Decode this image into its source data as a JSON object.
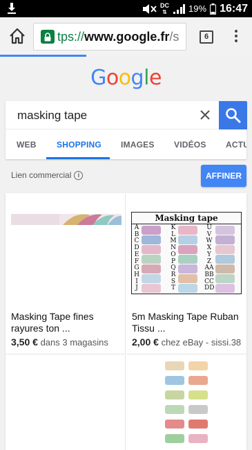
{
  "status_bar": {
    "network": "DC",
    "network_sub": "DC",
    "battery": "19%",
    "time": "16:47",
    "icons": [
      "download-icon",
      "mute-icon",
      "signal-icon",
      "battery-icon"
    ]
  },
  "browser": {
    "url_scheme": "tps://",
    "url_host": "www.google.fr",
    "url_rest": "/s",
    "tab_count": "6",
    "icons": [
      "home-icon",
      "lock-icon",
      "menu-icon"
    ]
  },
  "google": {
    "logo_letters": [
      "G",
      "o",
      "o",
      "g",
      "l",
      "e"
    ],
    "logo_colors": [
      "#4285F4",
      "#EA4335",
      "#FBBC05",
      "#4285F4",
      "#34A853",
      "#EA4335"
    ]
  },
  "search": {
    "query": "masking tape",
    "tabs": [
      "WEB",
      "SHOPPING",
      "IMAGES",
      "VIDÉOS",
      "ACTU"
    ],
    "active_tab": "SHOPPING"
  },
  "commercial": {
    "label": "Lien commercial",
    "filter_button": "AFFINER"
  },
  "products": [
    {
      "title": "Masking Tape fines rayures ton ...",
      "price": "3,50 €",
      "source": "dans 3 magasins"
    },
    {
      "title": "5m Masking Tape Ruban Tissu ...",
      "price": "2,00 €",
      "source": "chez eBay - sissi.38",
      "image_title": "Masking tape",
      "image_letters": [
        "ABCDEFGHIJ",
        "KLMNOPQRST",
        "UVWXYZAABBCCDD"
      ]
    }
  ],
  "colors": {
    "accent": "#4285F4",
    "active_tab": "#1A73E8",
    "lock": "#0B8043"
  }
}
